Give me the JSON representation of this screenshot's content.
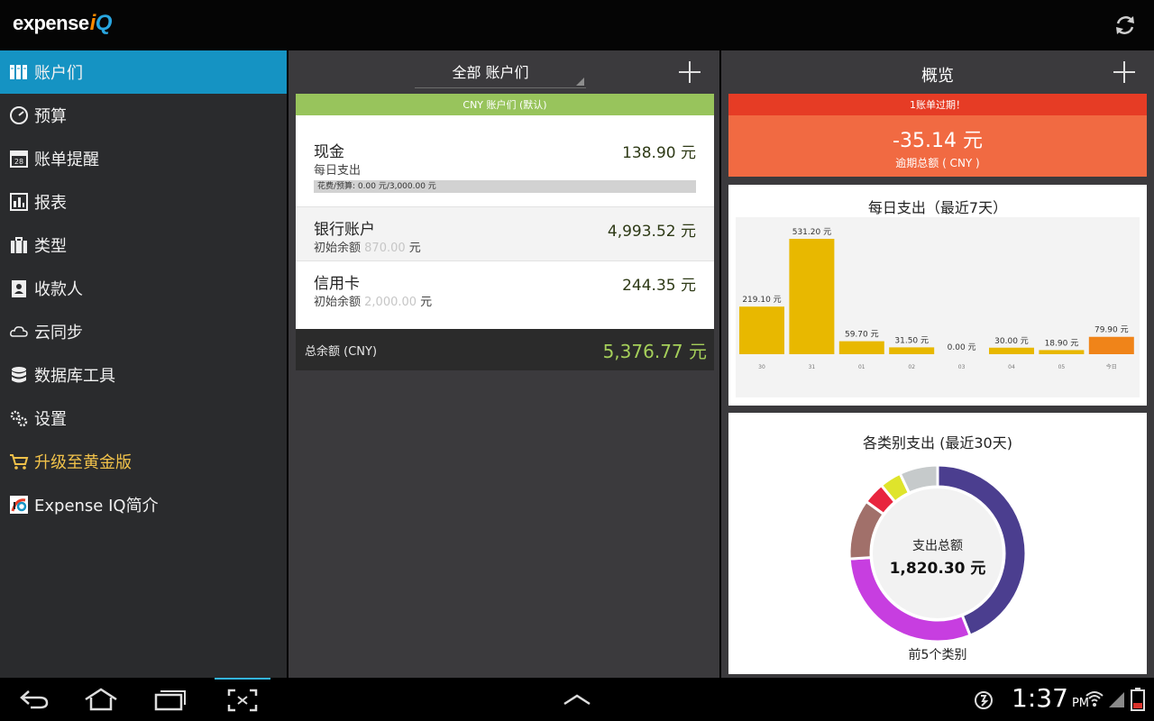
{
  "app": {
    "logo_text": "expense",
    "logo_i": "i",
    "logo_q": "Q"
  },
  "sidebar": {
    "items": [
      {
        "label": "账户们",
        "icon": "accounts-icon"
      },
      {
        "label": "预算",
        "icon": "budget-gauge-icon"
      },
      {
        "label": "账单提醒",
        "icon": "calendar-icon"
      },
      {
        "label": "报表",
        "icon": "report-chart-icon"
      },
      {
        "label": "类型",
        "icon": "briefcase-icon"
      },
      {
        "label": "收款人",
        "icon": "contact-card-icon"
      },
      {
        "label": "云同步",
        "icon": "cloud-icon"
      },
      {
        "label": "数据库工具",
        "icon": "database-icon"
      },
      {
        "label": "设置",
        "icon": "gear-icon"
      },
      {
        "label": "升级至黄金版",
        "icon": "cart-icon"
      },
      {
        "label": "Expense IQ简介",
        "icon": "app-logo-icon"
      }
    ]
  },
  "middle": {
    "dropdown_label": "全部 账户们",
    "group_header": "CNY 账户们 (默认)",
    "accounts": [
      {
        "name": "现金",
        "sub": "每日支出",
        "amount": "138.90 元",
        "budget_text": "花费/预算: 0.00 元/3,000.00 元"
      },
      {
        "name": "银行账户",
        "sub_prefix": "初始余额",
        "sub_ghost": " 870.00",
        "sub_suffix": " 元",
        "amount": "4,993.52 元"
      },
      {
        "name": "信用卡",
        "sub_prefix": "初始余额",
        "sub_ghost": " 2,000.00",
        "sub_suffix": " 元",
        "amount": "244.35 元"
      }
    ],
    "total_label": "总余额 (CNY)",
    "total_amount": "5,376.77 元"
  },
  "right": {
    "title": "概览",
    "overdue_header": "1账单过期！",
    "overdue_amount": "-35.14 元",
    "overdue_label": "逾期总额 ( CNY )",
    "pie_title": "各类别支出 (最近30天)",
    "pie_center_label": "支出总额",
    "pie_center_value": "1,820.30 元",
    "pie_footer": "前5个类别"
  },
  "chart_data": [
    {
      "type": "bar",
      "title": "每日支出（最近7天）",
      "categories": [
        "30",
        "31",
        "01",
        "02",
        "03",
        "04",
        "05",
        "今日"
      ],
      "values": [
        219.1,
        531.2,
        59.7,
        31.5,
        0.0,
        30.0,
        18.9,
        79.9
      ],
      "data_labels": [
        "219.10 元",
        "531.20 元",
        "59.70 元",
        "31.50 元",
        "0.00 元",
        "30.00 元",
        "18.90 元",
        "79.90 元"
      ],
      "colors": [
        "#e8b800",
        "#e8b800",
        "#e8b800",
        "#e8b800",
        "#e8b800",
        "#e8b800",
        "#e8b800",
        "#f08419"
      ],
      "ylim": [
        0,
        531.2
      ]
    },
    {
      "type": "pie",
      "title": "各类别支出 (最近30天)",
      "slices": [
        {
          "value": 0.44,
          "color": "#4b3e8f"
        },
        {
          "value": 0.3,
          "color": "#c73ee0"
        },
        {
          "value": 0.11,
          "color": "#a1706a"
        },
        {
          "value": 0.04,
          "color": "#e8253e"
        },
        {
          "value": 0.04,
          "color": "#dfe42b"
        },
        {
          "value": 0.07,
          "color": "#c6cacb"
        }
      ]
    }
  ],
  "system": {
    "time": "1:37",
    "ampm": "PM"
  }
}
